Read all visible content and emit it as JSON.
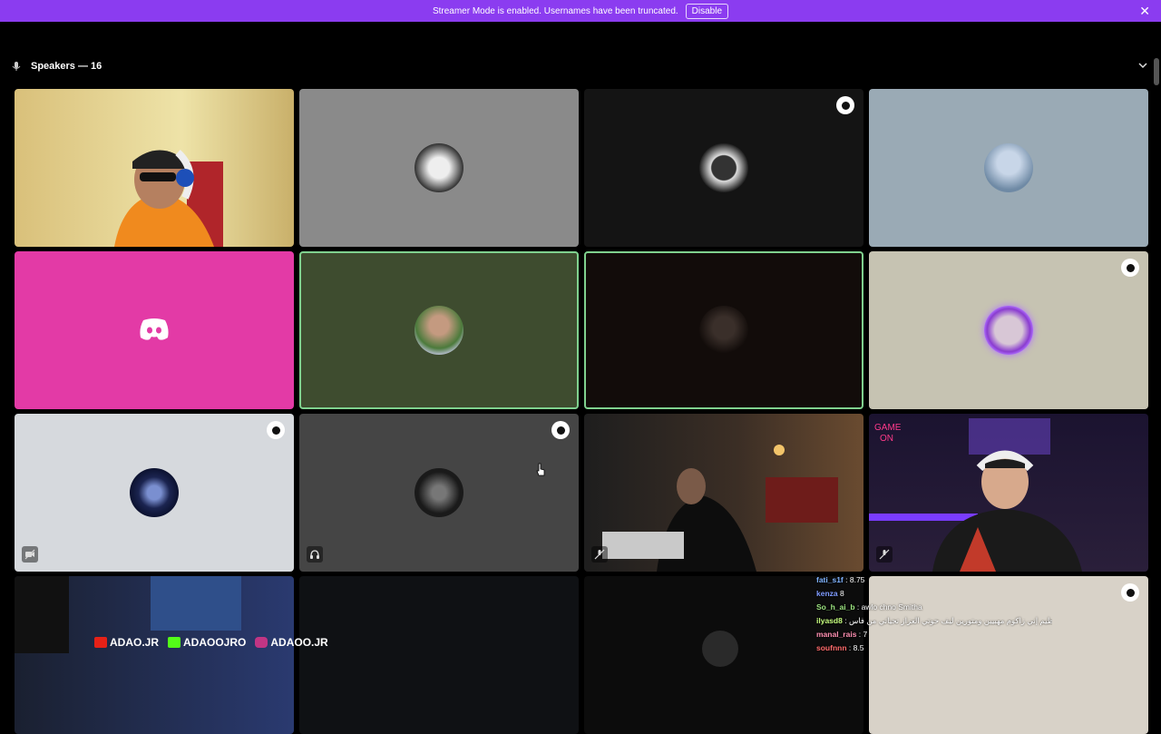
{
  "banner": {
    "message": "Streamer Mode is enabled. Usernames have been truncated.",
    "button": "Disable"
  },
  "stage": {
    "title": "Speakers — 16"
  },
  "chat": [
    {
      "user": "fati_s1f",
      "text": ": 8.75",
      "color": "#7fb3ff"
    },
    {
      "user": "kenza",
      "text": "8",
      "color": "#7f9bff"
    },
    {
      "user": "So_h_ai_b",
      "text": ": awlo chno Smitha",
      "color": "#9be37f"
    },
    {
      "user": "ilyasd8",
      "text": ": السيم بالله العلي العظيم إني زاكوم مهبيين ومتورين ليف حوتي العزاز تحياتي من فاس",
      "color": "#c7ff7f"
    },
    {
      "user": "manal_rais",
      "text": ": 7",
      "color": "#ff8fb1"
    },
    {
      "user": "soufnnn",
      "text": ": 8.5",
      "color": "#ff6b6b"
    }
  ],
  "social": {
    "youtube": "ADAO.JR",
    "kick": "ADAOOJRO",
    "instagram": "ADAOO.JR"
  },
  "colors": {
    "banner": "#8b3cf0",
    "discord_tile": "#e33aa6",
    "speaking": "#7fd18e"
  }
}
